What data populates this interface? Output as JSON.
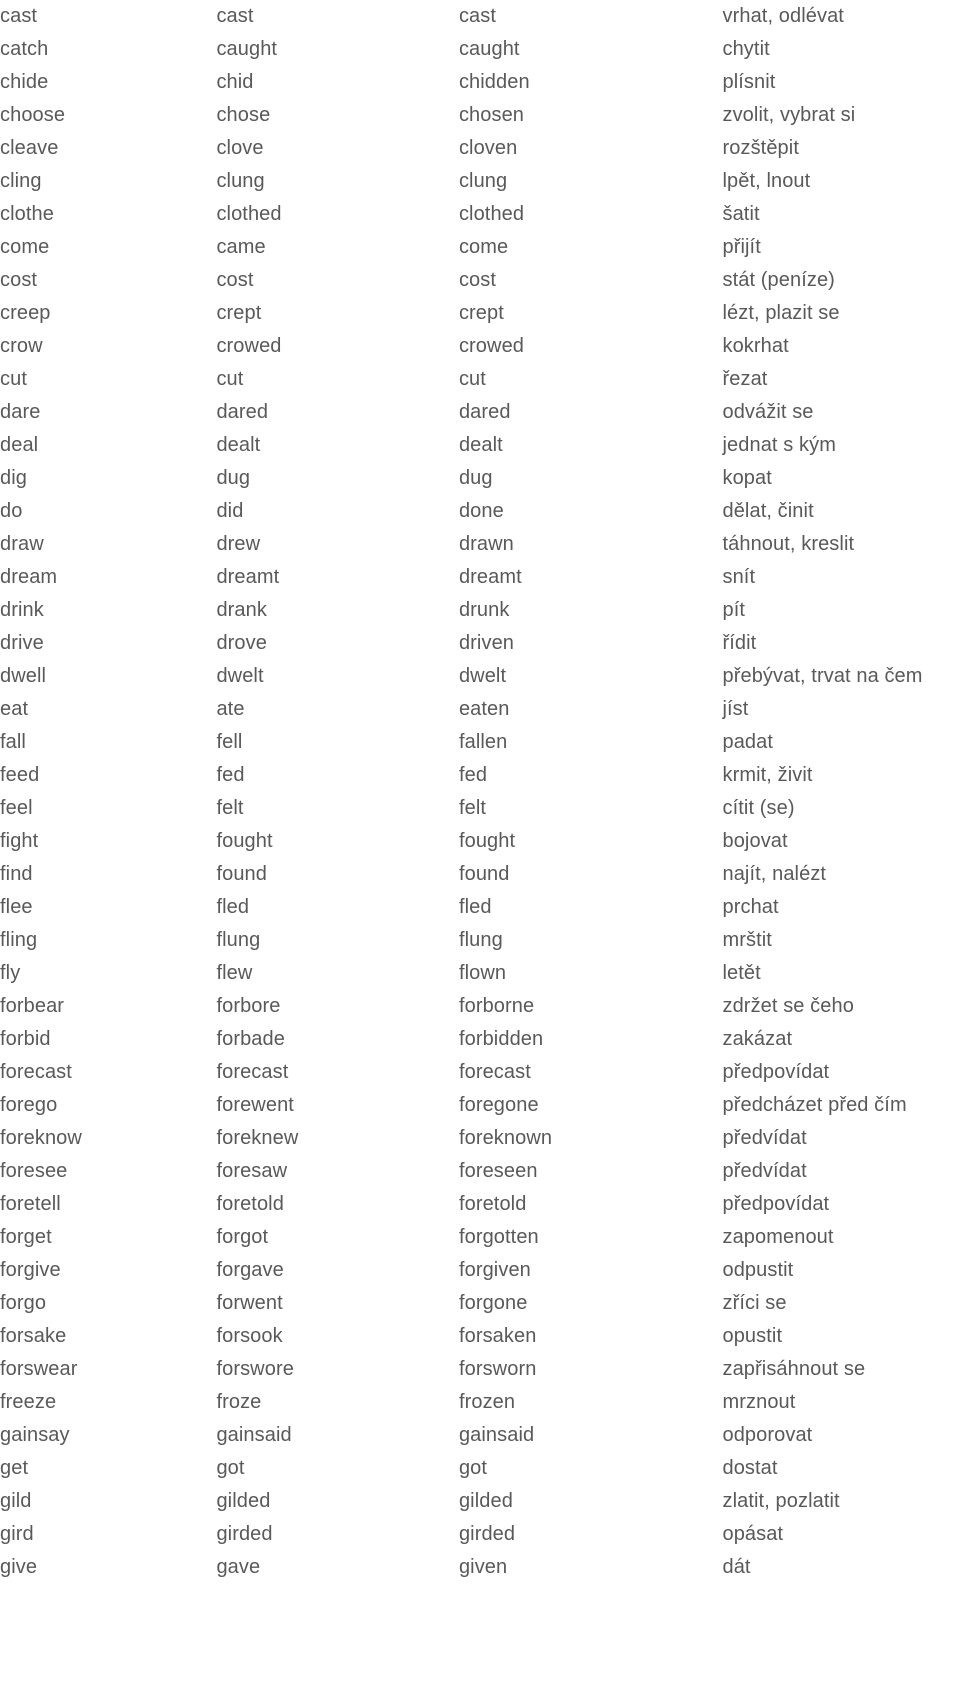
{
  "page": {
    "type": "irregular-verbs-table",
    "text_color": "#595959",
    "background_color": "#ffffff"
  },
  "table": {
    "columns": [
      "infinitive",
      "past_simple",
      "past_participle",
      "czech_meaning"
    ],
    "rows": [
      [
        "cast",
        "cast",
        "cast",
        "vrhat, odlévat"
      ],
      [
        "catch",
        "caught",
        "caught",
        "chytit"
      ],
      [
        "chide",
        "chid",
        "chidden",
        "plísnit"
      ],
      [
        "choose",
        "chose",
        "chosen",
        "zvolit, vybrat si"
      ],
      [
        "cleave",
        "clove",
        "cloven",
        "rozštěpit"
      ],
      [
        "cling",
        "clung",
        "clung",
        "lpět, lnout"
      ],
      [
        "clothe",
        "clothed",
        "clothed",
        "šatit"
      ],
      [
        "come",
        "came",
        "come",
        "přijít"
      ],
      [
        "cost",
        "cost",
        "cost",
        "stát (peníze)"
      ],
      [
        "creep",
        "crept",
        "crept",
        "lézt, plazit se"
      ],
      [
        "crow",
        "crowed",
        "crowed",
        "kokrhat"
      ],
      [
        "cut",
        "cut",
        "cut",
        "řezat"
      ],
      [
        "dare",
        "dared",
        "dared",
        "odvážit se"
      ],
      [
        "deal",
        "dealt",
        "dealt",
        "jednat s kým"
      ],
      [
        "dig",
        "dug",
        "dug",
        "kopat"
      ],
      [
        "do",
        "did",
        "done",
        "dělat, činit"
      ],
      [
        "draw",
        "drew",
        "drawn",
        "táhnout, kreslit"
      ],
      [
        "dream",
        "dreamt",
        "dreamt",
        "snít"
      ],
      [
        "drink",
        "drank",
        "drunk",
        "pít"
      ],
      [
        "drive",
        "drove",
        "driven",
        "řídit"
      ],
      [
        "dwell",
        "dwelt",
        "dwelt",
        "přebývat, trvat na čem"
      ],
      [
        "eat",
        "ate",
        "eaten",
        "jíst"
      ],
      [
        "fall",
        "fell",
        "fallen",
        "padat"
      ],
      [
        "feed",
        "fed",
        "fed",
        "krmit, živit"
      ],
      [
        "feel",
        "felt",
        "felt",
        "cítit (se)"
      ],
      [
        "fight",
        "fought",
        "fought",
        "bojovat"
      ],
      [
        "find",
        "found",
        "found",
        "najít, nalézt"
      ],
      [
        "flee",
        "fled",
        "fled",
        "prchat"
      ],
      [
        "fling",
        "flung",
        "flung",
        "mrštit"
      ],
      [
        "fly",
        "flew",
        "flown",
        "letět"
      ],
      [
        "forbear",
        "forbore",
        "forborne",
        "zdržet se čeho"
      ],
      [
        "forbid",
        "forbade",
        "forbidden",
        "zakázat"
      ],
      [
        "forecast",
        "forecast",
        "forecast",
        "předpovídat"
      ],
      [
        "forego",
        "forewent",
        "foregone",
        "předcházet před čím"
      ],
      [
        "foreknow",
        "foreknew",
        "foreknown",
        "předvídat"
      ],
      [
        "foresee",
        "foresaw",
        "foreseen",
        "předvídat"
      ],
      [
        "foretell",
        "foretold",
        "foretold",
        "předpovídat"
      ],
      [
        "forget",
        "forgot",
        "forgotten",
        "zapomenout"
      ],
      [
        "forgive",
        "forgave",
        "forgiven",
        "odpustit"
      ],
      [
        "forgo",
        "forwent",
        "forgone",
        "zříci se"
      ],
      [
        "forsake",
        "forsook",
        "forsaken",
        "opustit"
      ],
      [
        "forswear",
        "forswore",
        "forsworn",
        "zapřisáhnout se"
      ],
      [
        "freeze",
        "froze",
        "frozen",
        "mrznout"
      ],
      [
        "gainsay",
        "gainsaid",
        "gainsaid",
        "odporovat"
      ],
      [
        "get",
        "got",
        "got",
        "dostat"
      ],
      [
        "gild",
        "gilded",
        "gilded",
        "zlatit, pozlatit"
      ],
      [
        "gird",
        "girded",
        "girded",
        "opásat"
      ],
      [
        "give",
        "gave",
        "given",
        "dát"
      ]
    ]
  }
}
